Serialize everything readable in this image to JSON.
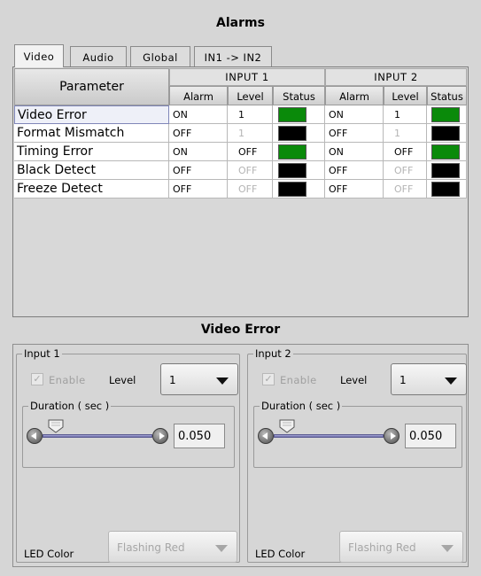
{
  "window": {
    "title": "Alarms"
  },
  "tabs": [
    {
      "label": "Video",
      "active": true
    },
    {
      "label": "Audio",
      "active": false
    },
    {
      "label": "Global",
      "active": false
    },
    {
      "label": "IN1 -> IN2",
      "active": false
    }
  ],
  "table": {
    "param_header": "Parameter",
    "input1_header": "INPUT 1",
    "input2_header": "INPUT 2",
    "sub_headers": {
      "alarm": "Alarm",
      "level": "Level",
      "status": "Status"
    },
    "rows": [
      {
        "param": "Video Error",
        "in1": {
          "alarm": "ON",
          "level": "1",
          "status": "#0a8a0a"
        },
        "in2": {
          "alarm": "ON",
          "level": "1",
          "status": "#0a8a0a"
        }
      },
      {
        "param": "Format Mismatch",
        "in1": {
          "alarm": "OFF",
          "level": "1",
          "status": "#000000"
        },
        "in2": {
          "alarm": "OFF",
          "level": "1",
          "status": "#000000"
        }
      },
      {
        "param": "Timing Error",
        "in1": {
          "alarm": "ON",
          "level": "OFF",
          "status": "#0a8a0a"
        },
        "in2": {
          "alarm": "ON",
          "level": "OFF",
          "status": "#0a8a0a"
        }
      },
      {
        "param": "Black Detect",
        "in1": {
          "alarm": "OFF",
          "level": "OFF",
          "status": "#000000"
        },
        "in2": {
          "alarm": "OFF",
          "level": "OFF",
          "status": "#000000"
        }
      },
      {
        "param": "Freeze Detect",
        "in1": {
          "alarm": "OFF",
          "level": "OFF",
          "status": "#000000"
        },
        "in2": {
          "alarm": "OFF",
          "level": "OFF",
          "status": "#000000"
        }
      }
    ]
  },
  "detail": {
    "title": "Video Error",
    "inputs": [
      {
        "legend": "Input 1",
        "enable_label": "Enable",
        "level_label": "Level",
        "level_value": "1",
        "duration_legend": "Duration ( sec )",
        "duration_value": "0.050",
        "led_label": "LED Color",
        "led_value": "Flashing Red"
      },
      {
        "legend": "Input 2",
        "enable_label": "Enable",
        "level_label": "Level",
        "level_value": "1",
        "duration_legend": "Duration ( sec )",
        "duration_value": "0.050",
        "led_label": "LED Color",
        "led_value": "Flashing Red"
      }
    ]
  },
  "colors": {
    "status_ok": "#0a8a0a",
    "status_off": "#000000",
    "slider_track": "#7a7ab8"
  }
}
